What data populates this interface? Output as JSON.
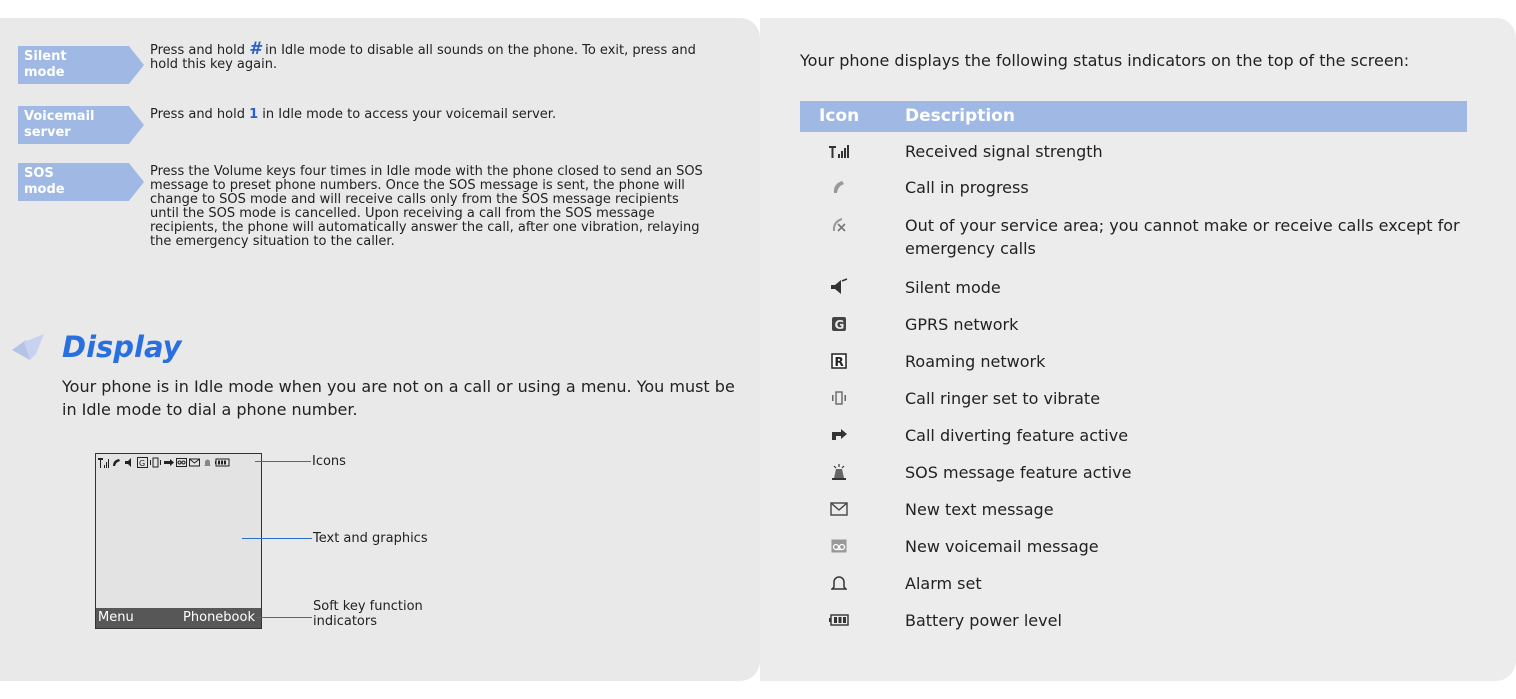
{
  "shortcuts": [
    {
      "label": "Silent mode",
      "label_line1": "Silent",
      "label_line2": "mode",
      "desc_pre": "Press and hold ",
      "desc_key": "#",
      "desc_post": " in Idle mode to disable all sounds on the phone. To exit, press and hold this key again."
    },
    {
      "label": "Voicemail server",
      "label_line1": "Voicemail",
      "label_line2": "server",
      "desc_pre": "Press and hold ",
      "desc_key": "1",
      "desc_post": " in Idle mode to access your voicemail server."
    },
    {
      "label": "SOS mode",
      "label_line1": "SOS",
      "label_line2": "mode",
      "desc": "Press the Volume keys four times in Idle mode with the phone closed to send an SOS message to preset phone numbers. Once the SOS message is sent, the phone will change to SOS mode and will receive calls only from the SOS message recipients until the SOS mode is cancelled. Upon receiving a call from the SOS message recipients, the phone will automatically answer the call, after one vibration, relaying the emergency situation to the caller."
    }
  ],
  "display": {
    "title": "Display",
    "body": "Your phone is in Idle mode when you are not on a call or using a menu. You must be in Idle mode to dial a phone number."
  },
  "phone": {
    "softkey_left": "Menu",
    "softkey_right": "Phonebook",
    "callouts": {
      "icons": "Icons",
      "text_graphics": "Text and graphics",
      "softkey_line1": "Soft key function",
      "softkey_line2": "indicators"
    }
  },
  "status": {
    "intro": "Your phone displays the following status indicators on the top of the screen:",
    "header_icon": "Icon",
    "header_desc": "Description",
    "rows": [
      {
        "icon": "signal-strength-icon",
        "text": "Received signal strength"
      },
      {
        "icon": "call-in-progress-icon",
        "text": "Call in progress"
      },
      {
        "icon": "no-service-icon",
        "text": "Out of your service area; you cannot make or receive calls except for emergency calls"
      },
      {
        "icon": "silent-mode-icon",
        "text": "Silent mode"
      },
      {
        "icon": "gprs-icon",
        "text": "GPRS network"
      },
      {
        "icon": "roaming-icon",
        "text": "Roaming network"
      },
      {
        "icon": "vibrate-icon",
        "text": "Call ringer set to vibrate"
      },
      {
        "icon": "call-divert-icon",
        "text": "Call diverting feature active"
      },
      {
        "icon": "sos-icon",
        "text": "SOS message feature active"
      },
      {
        "icon": "text-message-icon",
        "text": "New text message"
      },
      {
        "icon": "voicemail-icon",
        "text": "New voicemail message"
      },
      {
        "icon": "alarm-icon",
        "text": "Alarm set"
      },
      {
        "icon": "battery-icon",
        "text": "Battery power level"
      }
    ]
  },
  "colors": {
    "accent": "#a0b8e4",
    "title_blue": "#2a6fe0",
    "panel_gray": "#e9e9e9"
  }
}
